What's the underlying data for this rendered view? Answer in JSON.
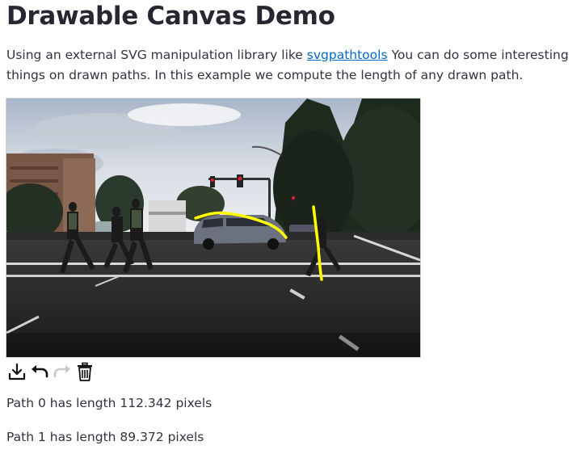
{
  "page": {
    "title": "Drawable Canvas Demo",
    "intro_before_link": "Using an external SVG manipulation library like ",
    "intro_link_text": "svgpathtools",
    "intro_after_link": " You can do some interesting things on drawn paths. In this example we compute the length of any drawn path."
  },
  "canvas": {
    "stroke_color": "#ffff00",
    "background_image": "street scene with pedestrians crossing, minivan, traffic lights and trees"
  },
  "toolbar": {
    "download_icon": "download-icon",
    "undo_icon": "undo-icon",
    "redo_icon": "redo-icon",
    "delete_icon": "trash-icon"
  },
  "results": [
    {
      "text": "Path 0 has length 112.342 pixels"
    },
    {
      "text": "Path 1 has length 89.372 pixels"
    }
  ]
}
